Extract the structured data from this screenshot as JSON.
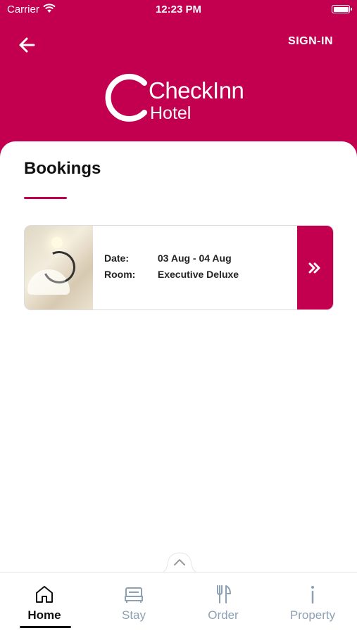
{
  "status_bar": {
    "carrier": "Carrier",
    "time": "12:23 PM"
  },
  "header": {
    "signin_label": "SIGN-IN",
    "brand_name": "CheckInn",
    "brand_sub": "Hotel",
    "background_color": "#c2004f"
  },
  "main": {
    "title": "Bookings"
  },
  "booking": {
    "date_label": "Date:",
    "date_value": "03 Aug - 04 Aug",
    "room_label": "Room:",
    "room_value": "Executive Deluxe"
  },
  "tabs": [
    {
      "label": "Home",
      "icon": "home-icon",
      "active": true
    },
    {
      "label": "Stay",
      "icon": "bed-icon",
      "active": false
    },
    {
      "label": "Order",
      "icon": "fork-knife-icon",
      "active": false
    },
    {
      "label": "Property",
      "icon": "info-icon",
      "active": false
    }
  ],
  "colors": {
    "accent": "#c2004f",
    "tab_inactive": "#8ea0b3",
    "tab_active": "#111111"
  }
}
